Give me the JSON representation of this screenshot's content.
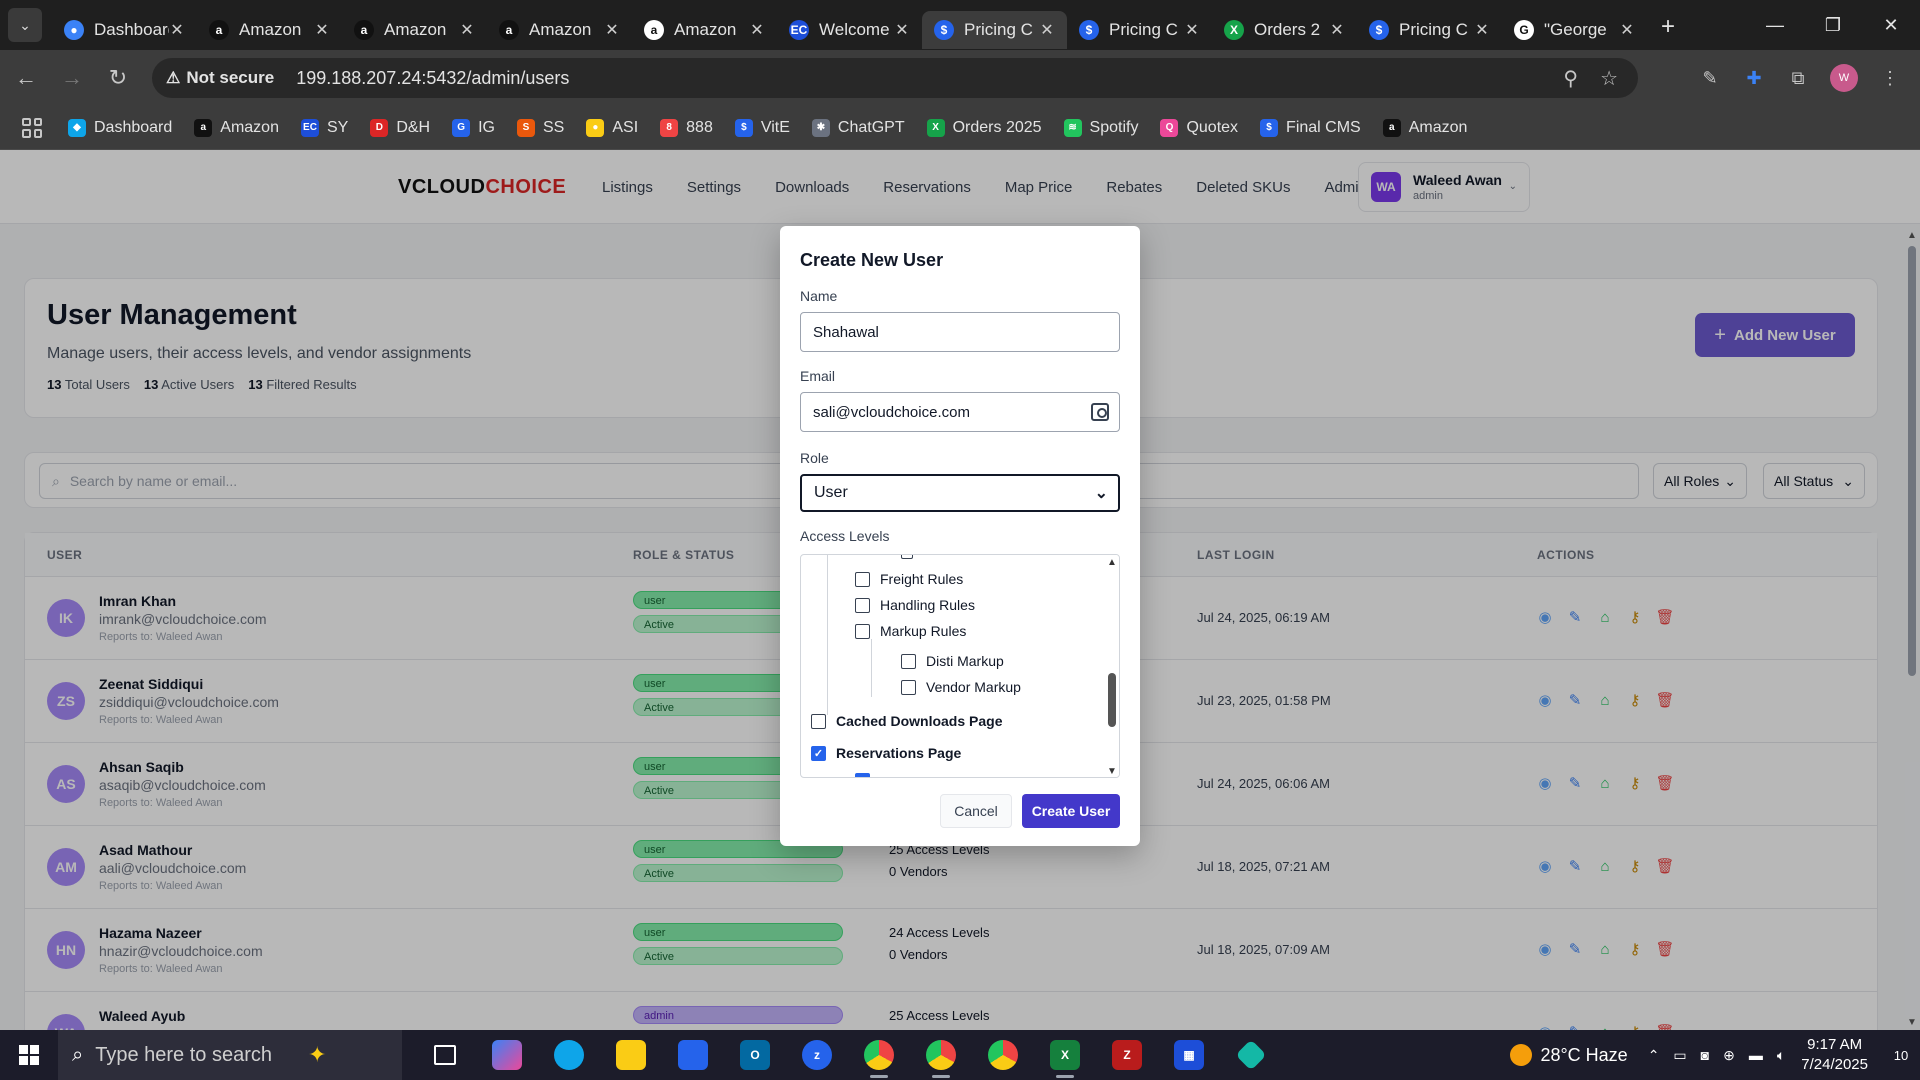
{
  "browser": {
    "tabs": [
      {
        "title": "Dashboard",
        "color": "#3b82f6",
        "glyph": "●"
      },
      {
        "title": "Amazon",
        "color": "#111111",
        "glyph": "a"
      },
      {
        "title": "Amazon",
        "color": "#111111",
        "glyph": "a"
      },
      {
        "title": "Amazon",
        "color": "#111111",
        "glyph": "a"
      },
      {
        "title": "Amazon",
        "color": "#ffffff",
        "glyph": "a"
      },
      {
        "title": "Welcome",
        "color": "#1d4ed8",
        "glyph": "EC"
      },
      {
        "title": "Pricing C",
        "color": "#2563eb",
        "glyph": "$"
      },
      {
        "title": "Pricing C",
        "color": "#2563eb",
        "glyph": "$"
      },
      {
        "title": "Orders 2",
        "color": "#16a34a",
        "glyph": "X"
      },
      {
        "title": "Pricing C",
        "color": "#2563eb",
        "glyph": "$"
      },
      {
        "title": "\"George",
        "color": "#ffffff",
        "glyph": "G"
      }
    ],
    "active_tab_index": 6,
    "security_label": "Not secure",
    "url": "199.188.207.24:5432/admin/users",
    "bookmarks": [
      {
        "label": "Dashboard",
        "color": "#0ea5e9",
        "glyph": "◆"
      },
      {
        "label": "Amazon",
        "color": "#111111",
        "glyph": "a"
      },
      {
        "label": "SY",
        "color": "#1d4ed8",
        "glyph": "EC"
      },
      {
        "label": "D&H",
        "color": "#dc2626",
        "glyph": "D"
      },
      {
        "label": "IG",
        "color": "#2563eb",
        "glyph": "G"
      },
      {
        "label": "SS",
        "color": "#ea580c",
        "glyph": "S"
      },
      {
        "label": "ASI",
        "color": "#facc15",
        "glyph": "●"
      },
      {
        "label": "888",
        "color": "#ef4444",
        "glyph": "8"
      },
      {
        "label": "VitE",
        "color": "#2563eb",
        "glyph": "$"
      },
      {
        "label": "ChatGPT",
        "color": "#6b7280",
        "glyph": "✱"
      },
      {
        "label": "Orders 2025",
        "color": "#16a34a",
        "glyph": "X"
      },
      {
        "label": "Spotify",
        "color": "#22c55e",
        "glyph": "≋"
      },
      {
        "label": "Quotex",
        "color": "#ec4899",
        "glyph": "Q"
      },
      {
        "label": "Final CMS",
        "color": "#2563eb",
        "glyph": "$"
      },
      {
        "label": "Amazon",
        "color": "#111111",
        "glyph": "a"
      }
    ],
    "profile_initials": "W"
  },
  "app": {
    "logo_v": "V",
    "logo_cloud": "CLOUD",
    "logo_choice": "CHOICE",
    "nav": [
      "Listings",
      "Settings",
      "Downloads",
      "Reservations",
      "Map Price",
      "Rebates",
      "Deleted SKUs",
      "Admin"
    ],
    "user": {
      "initials": "WA",
      "name": "Waleed Awan",
      "role": "admin"
    },
    "page_title": "User Management",
    "page_subtitle": "Manage users, their access levels, and vendor assignments",
    "stats": {
      "total": "13",
      "total_label": "Total Users",
      "active": "13",
      "active_label": "Active Users",
      "filtered": "13",
      "filtered_label": "Filtered Results"
    },
    "add_user_label": "Add New User",
    "search_placeholder": "Search by name or email...",
    "filter_roles": "All Roles",
    "filter_status": "All Status",
    "columns": {
      "user": "USER",
      "role_status": "ROLE & STATUS",
      "last_login": "LAST LOGIN",
      "actions": "ACTIONS"
    },
    "rows": [
      {
        "initials": "IK",
        "name": "Imran Khan",
        "email": "imrank@vcloudchoice.com",
        "reports": "Reports to: Waleed Awan",
        "role": "user",
        "status": "Active",
        "access": "",
        "vendors": "",
        "last_login": "Jul 24, 2025, 06:19 AM"
      },
      {
        "initials": "ZS",
        "name": "Zeenat Siddiqui",
        "email": "zsiddiqui@vcloudchoice.com",
        "reports": "Reports to: Waleed Awan",
        "role": "user",
        "status": "Active",
        "access": "",
        "vendors": "",
        "last_login": "Jul 23, 2025, 01:58 PM"
      },
      {
        "initials": "AS",
        "name": "Ahsan Saqib",
        "email": "asaqib@vcloudchoice.com",
        "reports": "Reports to: Waleed Awan",
        "role": "user",
        "status": "Active",
        "access": "",
        "vendors": "",
        "last_login": "Jul 24, 2025, 06:06 AM"
      },
      {
        "initials": "AM",
        "name": "Asad Mathour",
        "email": "aali@vcloudchoice.com",
        "reports": "Reports to: Waleed Awan",
        "role": "user",
        "status": "Active",
        "access": "25 Access Levels",
        "vendors": "0 Vendors",
        "last_login": "Jul 18, 2025, 07:21 AM"
      },
      {
        "initials": "HN",
        "name": "Hazama Nazeer",
        "email": "hnazir@vcloudchoice.com",
        "reports": "Reports to: Waleed Awan",
        "role": "user",
        "status": "Active",
        "access": "24 Access Levels",
        "vendors": "0 Vendors",
        "last_login": "Jul 18, 2025, 07:09 AM"
      },
      {
        "initials": "WA",
        "name": "Waleed Ayub",
        "email": "",
        "reports": "",
        "role": "admin",
        "status": "",
        "access": "25 Access Levels",
        "vendors": "",
        "last_login": ""
      }
    ]
  },
  "modal": {
    "title": "Create New User",
    "name_label": "Name",
    "name_value": "Shahawal",
    "email_label": "Email",
    "email_value": "sali@vcloudchoice.com",
    "role_label": "Role",
    "role_value": "User",
    "access_label": "Access Levels",
    "access_items": [
      {
        "label": "Freight Rules",
        "checked": false,
        "level": 1
      },
      {
        "label": "Handling Rules",
        "checked": false,
        "level": 1
      },
      {
        "label": "Markup Rules",
        "checked": false,
        "level": 1
      },
      {
        "label": "Disti Markup",
        "checked": false,
        "level": 2
      },
      {
        "label": "Vendor Markup",
        "checked": false,
        "level": 2
      },
      {
        "label": "Cached Downloads Page",
        "checked": false,
        "level": 0
      },
      {
        "label": "Reservations Page",
        "checked": true,
        "level": 0
      }
    ],
    "cancel_label": "Cancel",
    "create_label": "Create User"
  },
  "taskbar": {
    "search_placeholder": "Type here to search",
    "weather": "28°C Haze",
    "time": "9:17 AM",
    "date": "7/24/2025",
    "notifications": "10"
  },
  "colors": {
    "accent": "#6d5bd0",
    "primary_button": "#4338ca",
    "active_badge": "#bbf7d0",
    "admin_badge": "#c4b5fd"
  }
}
